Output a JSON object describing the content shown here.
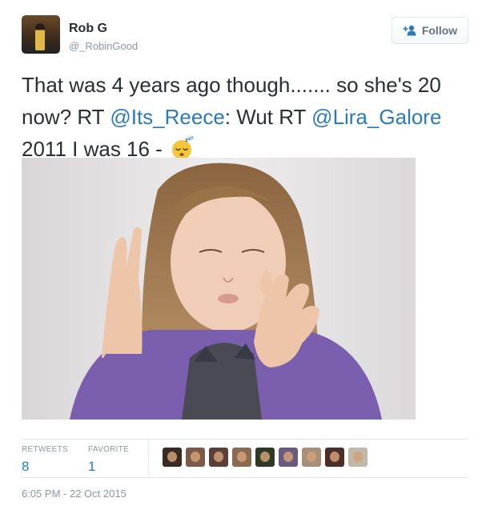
{
  "user": {
    "name": "Rob G",
    "handle": "@_RobinGood"
  },
  "follow": {
    "label": "Follow"
  },
  "tweet": {
    "text_1": "That was 4 years ago though....... so she's 20 now? RT ",
    "mention_1": "@Its_Reece",
    "text_2": ": Wut RT ",
    "mention_2": "@Lira_Galore",
    "text_3": " 2011 I was 16 - ",
    "emoji": "sleeping-face-icon"
  },
  "stats": {
    "retweets_label": "RETWEETS",
    "retweets_value": "8",
    "favorites_label": "FAVORITE",
    "favorites_value": "1"
  },
  "timestamp": "6:05 PM - 22 Oct 2015",
  "colors": {
    "link": "#2b7bb9",
    "muted": "#8899a6",
    "text": "#292f33",
    "border": "#e1e8ed"
  },
  "favoriters": [
    {
      "color": "#3a2a24"
    },
    {
      "color": "#7a5a48"
    },
    {
      "color": "#5a4038"
    },
    {
      "color": "#8a6a50"
    },
    {
      "color": "#2f3a26"
    },
    {
      "color": "#6a5a80"
    },
    {
      "color": "#a89078"
    },
    {
      "color": "#4a3028"
    },
    {
      "color": "#c0b8a8"
    }
  ]
}
